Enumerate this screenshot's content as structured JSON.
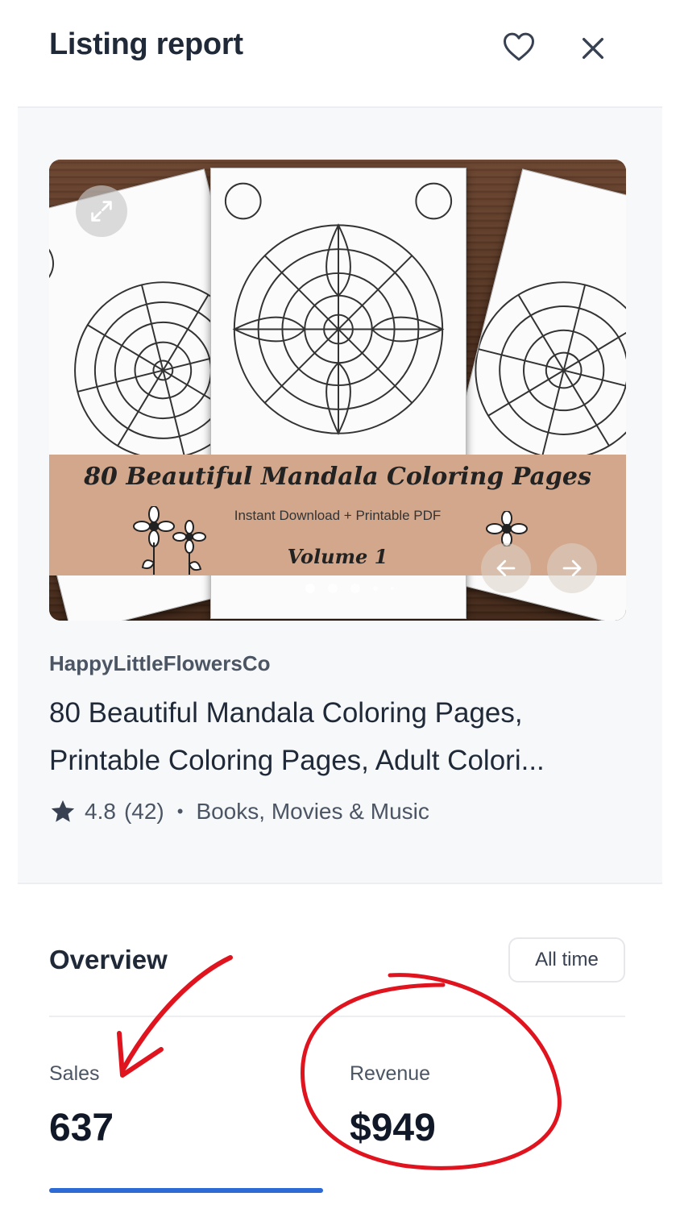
{
  "header": {
    "title": "Listing report"
  },
  "carousel": {
    "image_banner_title": "80 Beautiful Mandala Coloring Pages",
    "image_banner_subtitle": "Instant Download + Printable PDF",
    "image_banner_volume": "Volume 1",
    "dot_count": 5,
    "active_dot_index": 0
  },
  "listing": {
    "shop_name": "HappyLittleFlowersCo",
    "title_line1": "80 Beautiful Mandala Coloring Pages,",
    "title_line2": "Printable Coloring Pages, Adult Colori...",
    "rating": "4.8",
    "review_count": "(42)",
    "separator": "•",
    "category": "Books, Movies & Music"
  },
  "overview": {
    "label": "Overview",
    "range_button": "All time",
    "stats": {
      "sales_label": "Sales",
      "sales_value": "637",
      "revenue_label": "Revenue",
      "revenue_value": "$949"
    },
    "active_tab": "Sales"
  },
  "colors": {
    "accent": "#2d6ad6",
    "annotation": "#e0141e",
    "banner": "#d3a78c",
    "section_bg": "#f7f8fa"
  },
  "icons": [
    "heart-icon",
    "close-icon",
    "expand-icon",
    "arrow-left-icon",
    "arrow-right-icon",
    "star-icon"
  ]
}
